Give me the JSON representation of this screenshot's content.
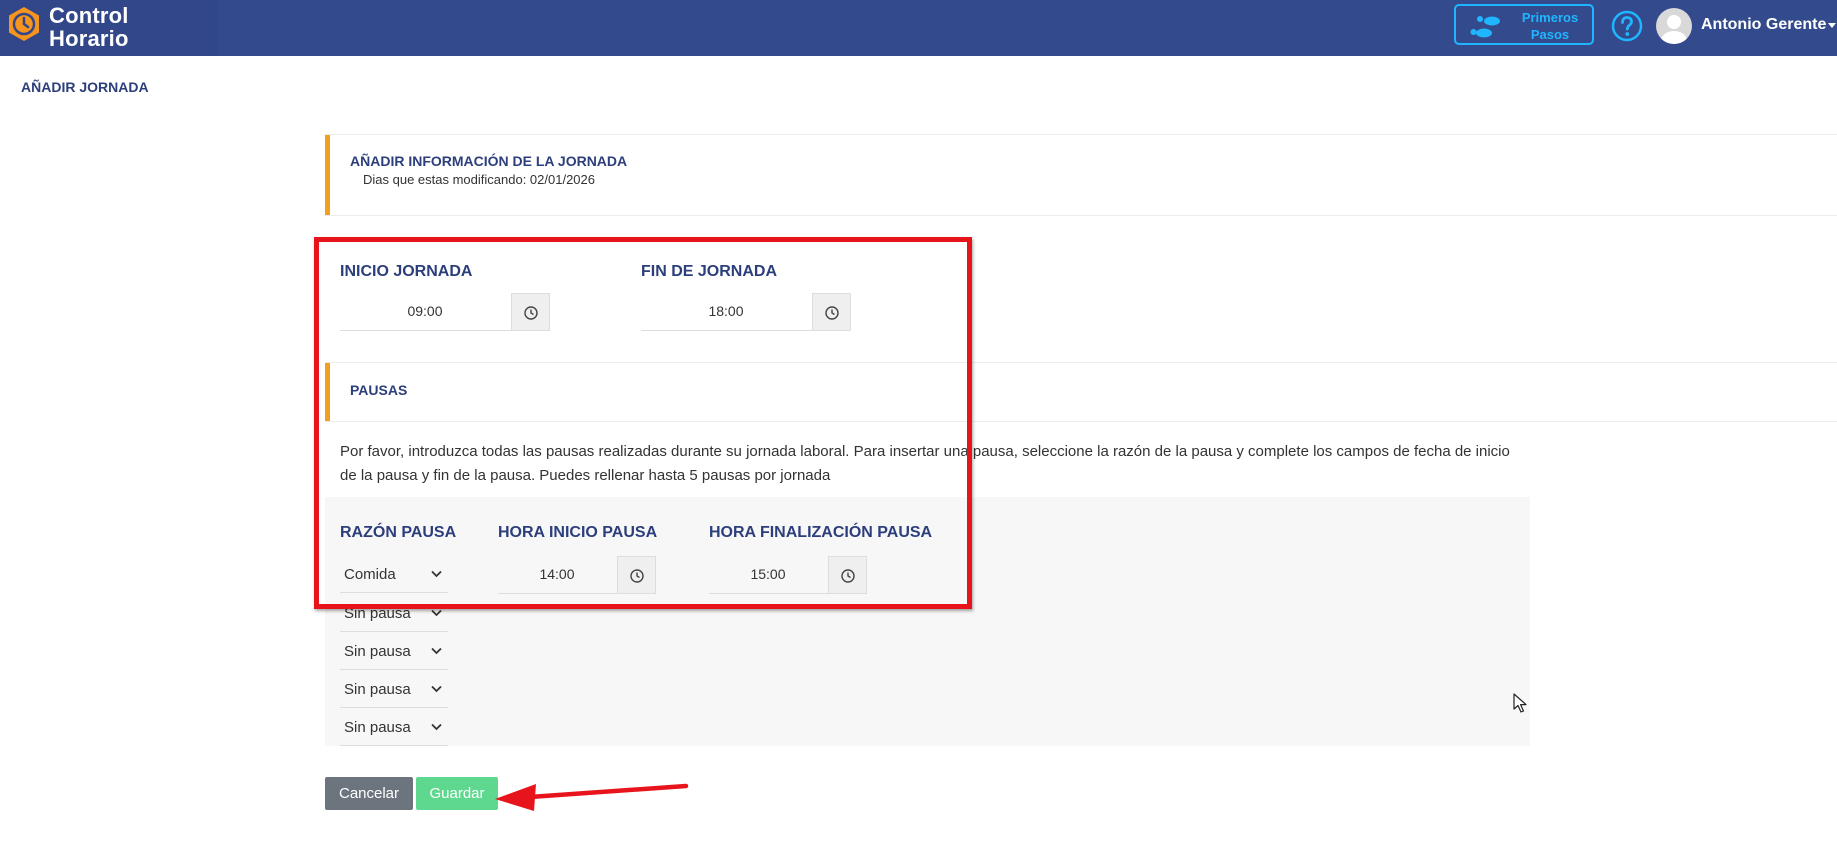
{
  "header": {
    "logo_line1": "Control",
    "logo_line2": "Horario",
    "primeros_line1": "Primeros",
    "primeros_line2": "Pasos",
    "user_name": "Antonio Gerente",
    "brand_color": "#334a8c",
    "accent_color": "#1fb6ff"
  },
  "page": {
    "title": "AÑADIR JORNADA"
  },
  "info_section": {
    "title": "AÑADIR INFORMACIÓN DE LA JORNADA",
    "subtitle": "Dias que estas modificando: 02/01/2026"
  },
  "jornada": {
    "inicio_label": "INICIO JORNADA",
    "inicio_value": "09:00",
    "fin_label": "FIN DE JORNADA",
    "fin_value": "18:00"
  },
  "pausas": {
    "title": "PAUSAS",
    "description": "Por favor, introduzca todas las pausas realizadas durante su jornada laboral. Para insertar una pausa, seleccione la razón de la pausa y complete los campos de fecha de inicio de la pausa y fin de la pausa. Puedes rellenar hasta 5 pausas por jornada",
    "razon_label": "RAZÓN PAUSA",
    "inicio_label": "HORA INICIO PAUSA",
    "fin_label": "HORA FINALIZACIÓN PAUSA",
    "rows": [
      {
        "razon": "Comida",
        "inicio": "14:00",
        "fin": "15:00"
      },
      {
        "razon": "Sin pausa"
      },
      {
        "razon": "Sin pausa"
      },
      {
        "razon": "Sin pausa"
      },
      {
        "razon": "Sin pausa"
      }
    ]
  },
  "actions": {
    "cancel_label": "Cancelar",
    "save_label": "Guardar"
  },
  "icons": {
    "logo": "clock-logo-icon",
    "primeros": "footsteps-icon",
    "help": "question-circle-icon",
    "avatar": "user-avatar-icon",
    "time": "clock-icon",
    "select": "chevron-down-icon"
  }
}
